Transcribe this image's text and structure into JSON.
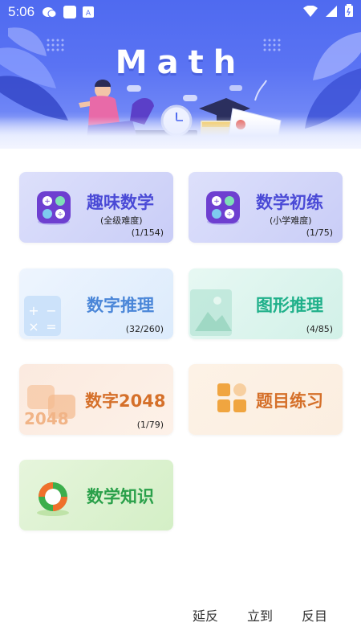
{
  "status": {
    "time": "5:06",
    "left_icons": [
      "wechat-icon",
      "app-square-icon",
      "text-a-icon"
    ],
    "right_icons": [
      "wifi-icon",
      "signal-icon",
      "battery-icon"
    ]
  },
  "banner": {
    "title": "Math",
    "colors": {
      "top": "#4f6af0",
      "bottom": "#dfe6ff"
    }
  },
  "cards": {
    "fun": {
      "title": "趣味数学",
      "subtitle": "(全级难度)",
      "count": "(1/154)",
      "color": "#4a4ad6"
    },
    "primary": {
      "title": "数学初练",
      "subtitle": "(小学难度)",
      "count": "(1/75)",
      "color": "#4a4ad6"
    },
    "number_reasoning": {
      "title": "数字推理",
      "count": "(32/260)",
      "color": "#4a86d8"
    },
    "shape_reasoning": {
      "title": "图形推理",
      "count": "(4/85)",
      "color": "#1fb08a"
    },
    "game_2048": {
      "title": "数字2048",
      "count": "(1/79)",
      "color": "#d5702a",
      "decor": "2048"
    },
    "exercise": {
      "title": "题目练习",
      "color": "#d5702a"
    },
    "knowledge": {
      "title": "数学知识",
      "color": "#2aa04a"
    }
  },
  "bottom_nav": {
    "items": [
      "延反",
      "立到",
      "反目"
    ]
  }
}
